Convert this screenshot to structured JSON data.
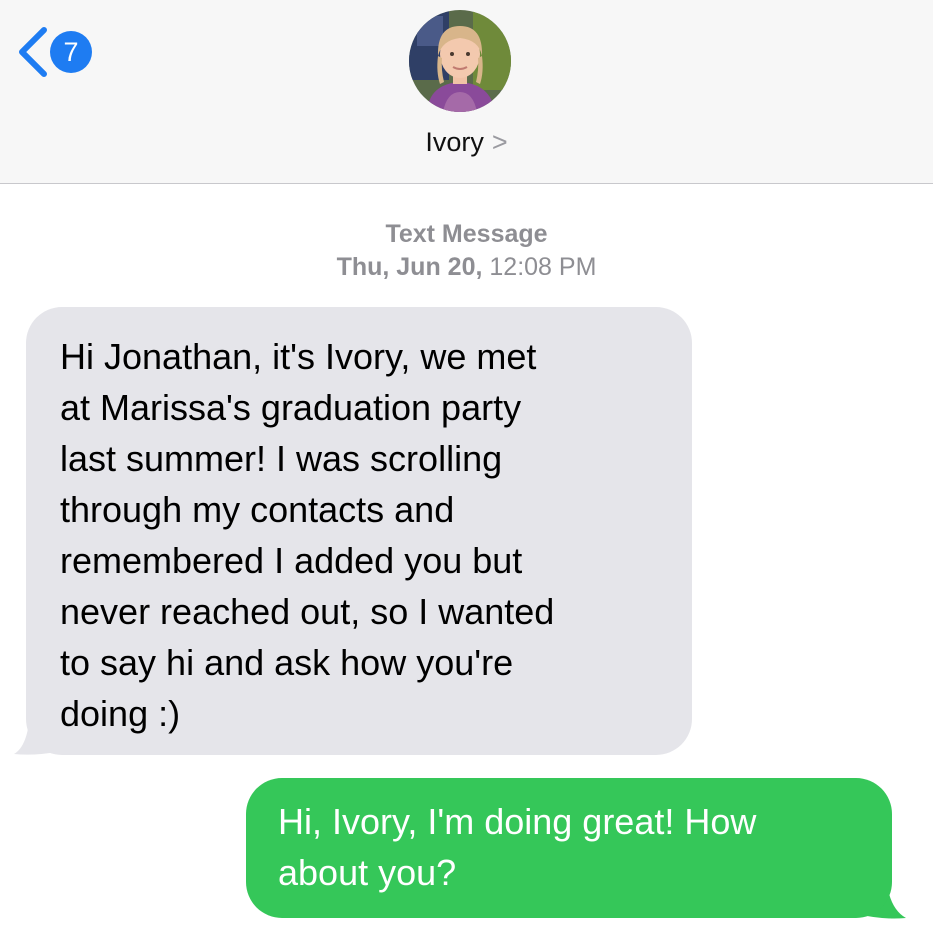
{
  "header": {
    "back_count": "7",
    "contact_name": "Ivory",
    "name_chevron": ">",
    "avatar_alt": "Ivory"
  },
  "thread": {
    "service": "Text Message",
    "date": "Thu, Jun 20,",
    "time": "12:08 PM"
  },
  "messages": [
    {
      "direction": "incoming",
      "lines": [
        "Hi Jonathan, it's Ivory, we met",
        "at Marissa's graduation party",
        "last summer! I was scrolling",
        "through my contacts and",
        "remembered I added you but",
        "never reached out, so I wanted",
        "to say hi and ask how you're",
        "doing :)"
      ]
    },
    {
      "direction": "outgoing",
      "lines": [
        "Hi, Ivory, I'm doing great! How",
        "about you?"
      ]
    }
  ],
  "colors": {
    "accent": "#1e7cf2",
    "incoming_bubble": "#e5e5ea",
    "outgoing_bubble": "#35c759",
    "meta_text": "#8e8e93"
  },
  "icons": {
    "back": "chevron-left-icon",
    "name": "chevron-right-icon"
  }
}
